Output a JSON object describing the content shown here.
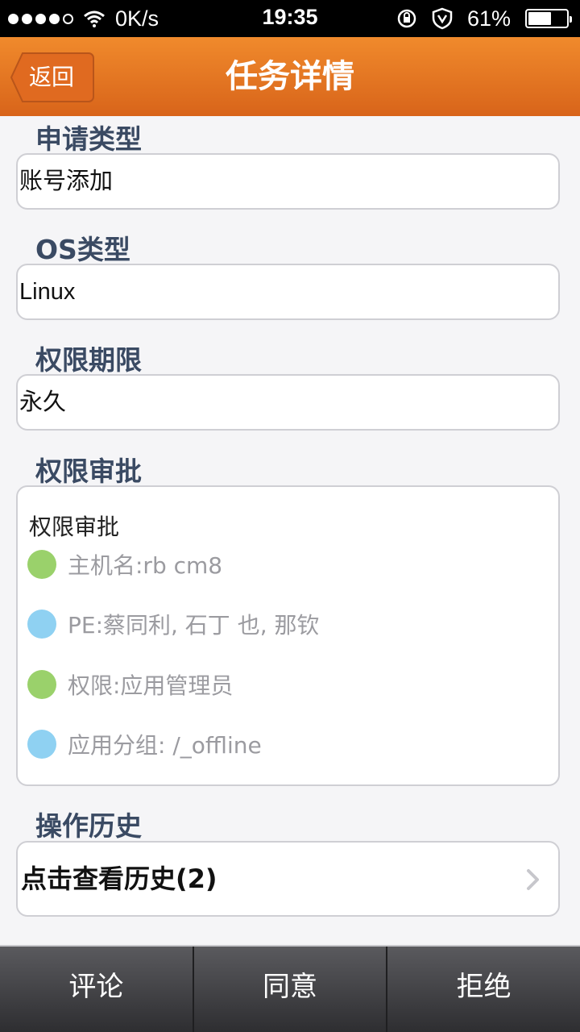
{
  "status_bar": {
    "network": "0K/s",
    "time": "19:35",
    "battery": "61%",
    "battery_level": 0.61
  },
  "nav": {
    "back_label": "返回",
    "title": "任务详情"
  },
  "sections": {
    "apply_type": {
      "title": "申请类型",
      "value": "账号添加"
    },
    "os_type": {
      "title": "OS类型",
      "value": "Linux"
    },
    "perm_period": {
      "title": "权限期限",
      "value": "永久"
    },
    "perm_approval": {
      "title": "权限审批",
      "box_heading": "权限审批",
      "items": [
        {
          "text": "主机名:rb                    cm8",
          "color": "#9ad16b"
        },
        {
          "text": "PE:蔡同利, 石丁                      也, 那钦",
          "color": "#8fd1f2"
        },
        {
          "text": "权限:应用管理员",
          "color": "#9ad16b"
        },
        {
          "text": "应用分组:                    /_offline",
          "color": "#8fd1f2"
        }
      ]
    },
    "history": {
      "title": "操作历史",
      "link_label": "点击查看历史(2)"
    }
  },
  "toolbar": {
    "comment": "评论",
    "agree": "同意",
    "reject": "拒绝"
  },
  "colors": {
    "nav_bg": "#e57424",
    "section_title": "#3a4a63"
  }
}
